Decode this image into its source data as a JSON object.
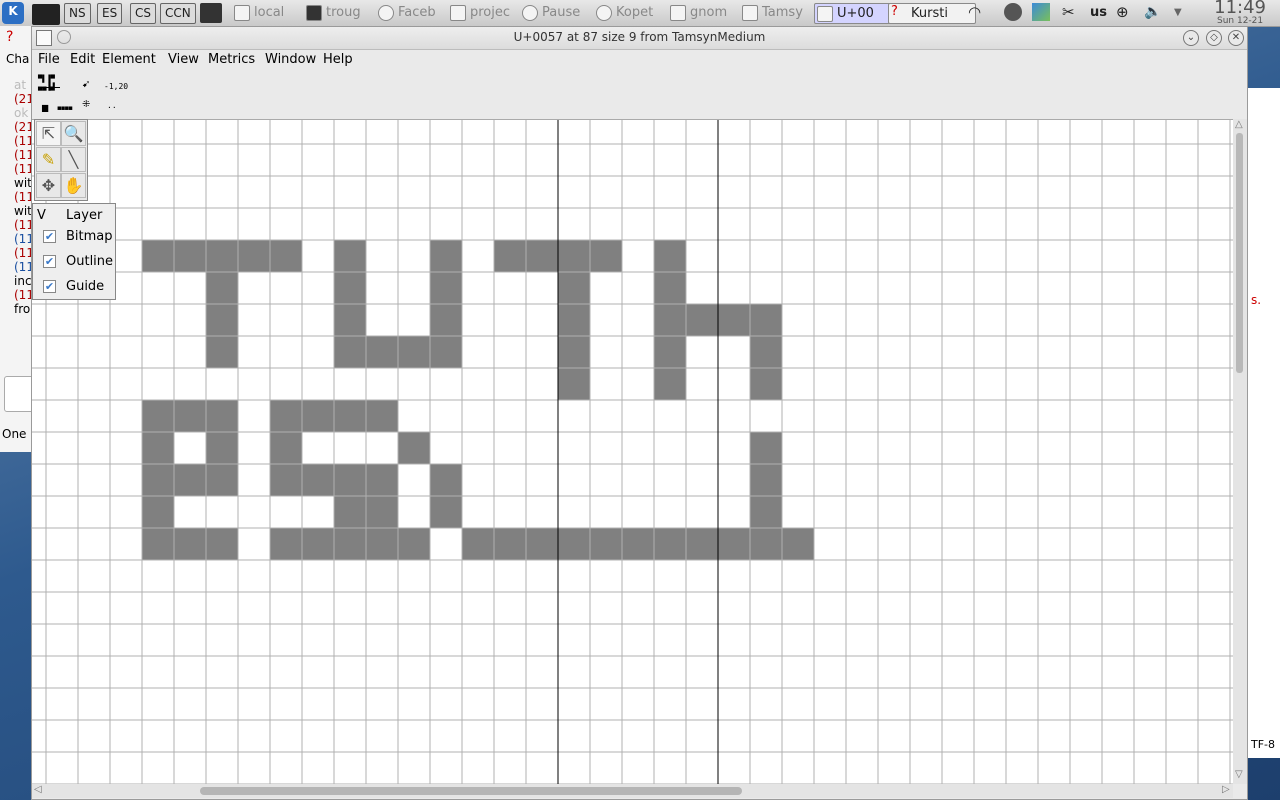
{
  "panel": {
    "pagers": [
      "NS",
      "ES",
      "CS",
      "CCN"
    ],
    "tasks": [
      "local",
      "troug",
      "Faceb",
      "projec",
      "Pause",
      "Kopet",
      "gnom",
      "Tamsy",
      "U+00",
      "Kursti"
    ],
    "keyboard_layout": "us",
    "clock_time": "11:49",
    "clock_date": "Sun 12-21"
  },
  "window": {
    "title": "U+0057 at 87 size 9 from TamsynMedium",
    "menus": [
      "File",
      "Edit",
      "Element",
      "View",
      "Metrics",
      "Window",
      "Help"
    ],
    "coord_readout": "-1,20",
    "coord_readout2": ".."
  },
  "layers": {
    "header_v": "V",
    "header_label": "Layer",
    "items": [
      {
        "label": "Bitmap",
        "checked": true
      },
      {
        "label": "Outline",
        "checked": true
      },
      {
        "label": "Guide",
        "checked": true
      }
    ]
  },
  "bitmap": {
    "fill_color": "#808080",
    "rows": [
      "#####.#..#.####.#...",
      "..#...#..#...#..#...",
      "..#...#..#...#..####",
      "..#...####...#..#..#",
      ".............#..#..#",
      "###.####............",
      "#.#.#...#..........#",
      "###.####.#.........#",
      "#.....##.#.........#",
      "###.#####.###########"
    ]
  },
  "left_window": {
    "lines": [
      "Cha",
      "at",
      "(21",
      "ok",
      "(21",
      "(11",
      "(11",
      "(11",
      "wit",
      "(11",
      "wit",
      "(11",
      "(11",
      "(11",
      "(11",
      "inc",
      "(11",
      "fro"
    ],
    "status": "One"
  },
  "colors": {
    "grid_line": "#b0b0b0",
    "metric_line": "#000000",
    "checkbox": "#3978c8"
  }
}
